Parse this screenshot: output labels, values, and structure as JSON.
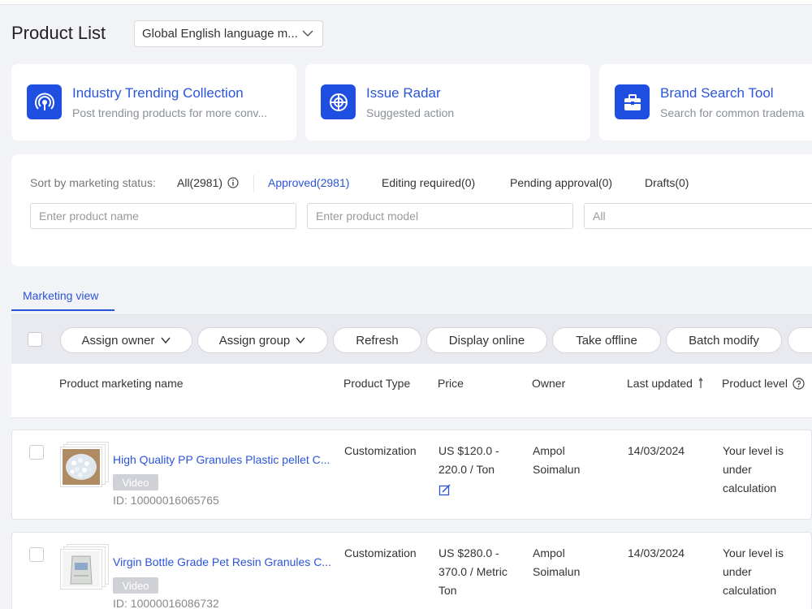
{
  "page": {
    "title": "Product List",
    "language_select": "Global English language m..."
  },
  "cards": [
    {
      "title": "Industry Trending Collection",
      "subtitle": "Post trending products for more conv...",
      "icon": "signal-icon"
    },
    {
      "title": "Issue Radar",
      "subtitle": "Suggested action",
      "icon": "radar-icon"
    },
    {
      "title": "Brand Search Tool",
      "subtitle": "Search for common tradema",
      "icon": "briefcase-icon"
    }
  ],
  "filters": {
    "label": "Sort by marketing status:",
    "statuses": [
      "All(2981)",
      "Approved(2981)",
      "Editing required(0)",
      "Pending approval(0)",
      "Drafts(0)"
    ],
    "product_name_placeholder": "Enter product name",
    "product_model_placeholder": "Enter product model",
    "select_value": "All"
  },
  "tab": {
    "label": "Marketing view"
  },
  "toolbar": {
    "actions": [
      "Assign owner",
      "Assign group",
      "Refresh",
      "Display online",
      "Take offline",
      "Batch modify"
    ]
  },
  "table": {
    "headers": [
      "Product marketing name",
      "Product Type",
      "Price",
      "Owner",
      "Last updated",
      "Product level"
    ],
    "rows": [
      {
        "name": "High Quality PP Granules Plastic pellet C...",
        "badge": "Video",
        "id": "ID: 10000016065765",
        "type": "Customization",
        "price": [
          "US $120.0 -",
          "220.0 / Ton"
        ],
        "owner": [
          "Ampol",
          "Soimalun"
        ],
        "updated": "14/03/2024",
        "level": [
          "Your level is",
          "under",
          "calculation"
        ]
      },
      {
        "name": "Virgin Bottle Grade Pet Resin Granules C...",
        "badge": "Video",
        "id": "ID: 10000016086732",
        "type": "Customization",
        "price": [
          "US $280.0 -",
          "370.0 / Metric",
          "Ton"
        ],
        "owner": [
          "Ampol",
          "Soimalun"
        ],
        "updated": "14/03/2024",
        "level": [
          "Your level is",
          "under",
          "calculation"
        ]
      }
    ]
  },
  "colors": {
    "accent": "#2b54d9",
    "icon_bg": "#1f4fe0",
    "background": "#f2f3f7"
  }
}
